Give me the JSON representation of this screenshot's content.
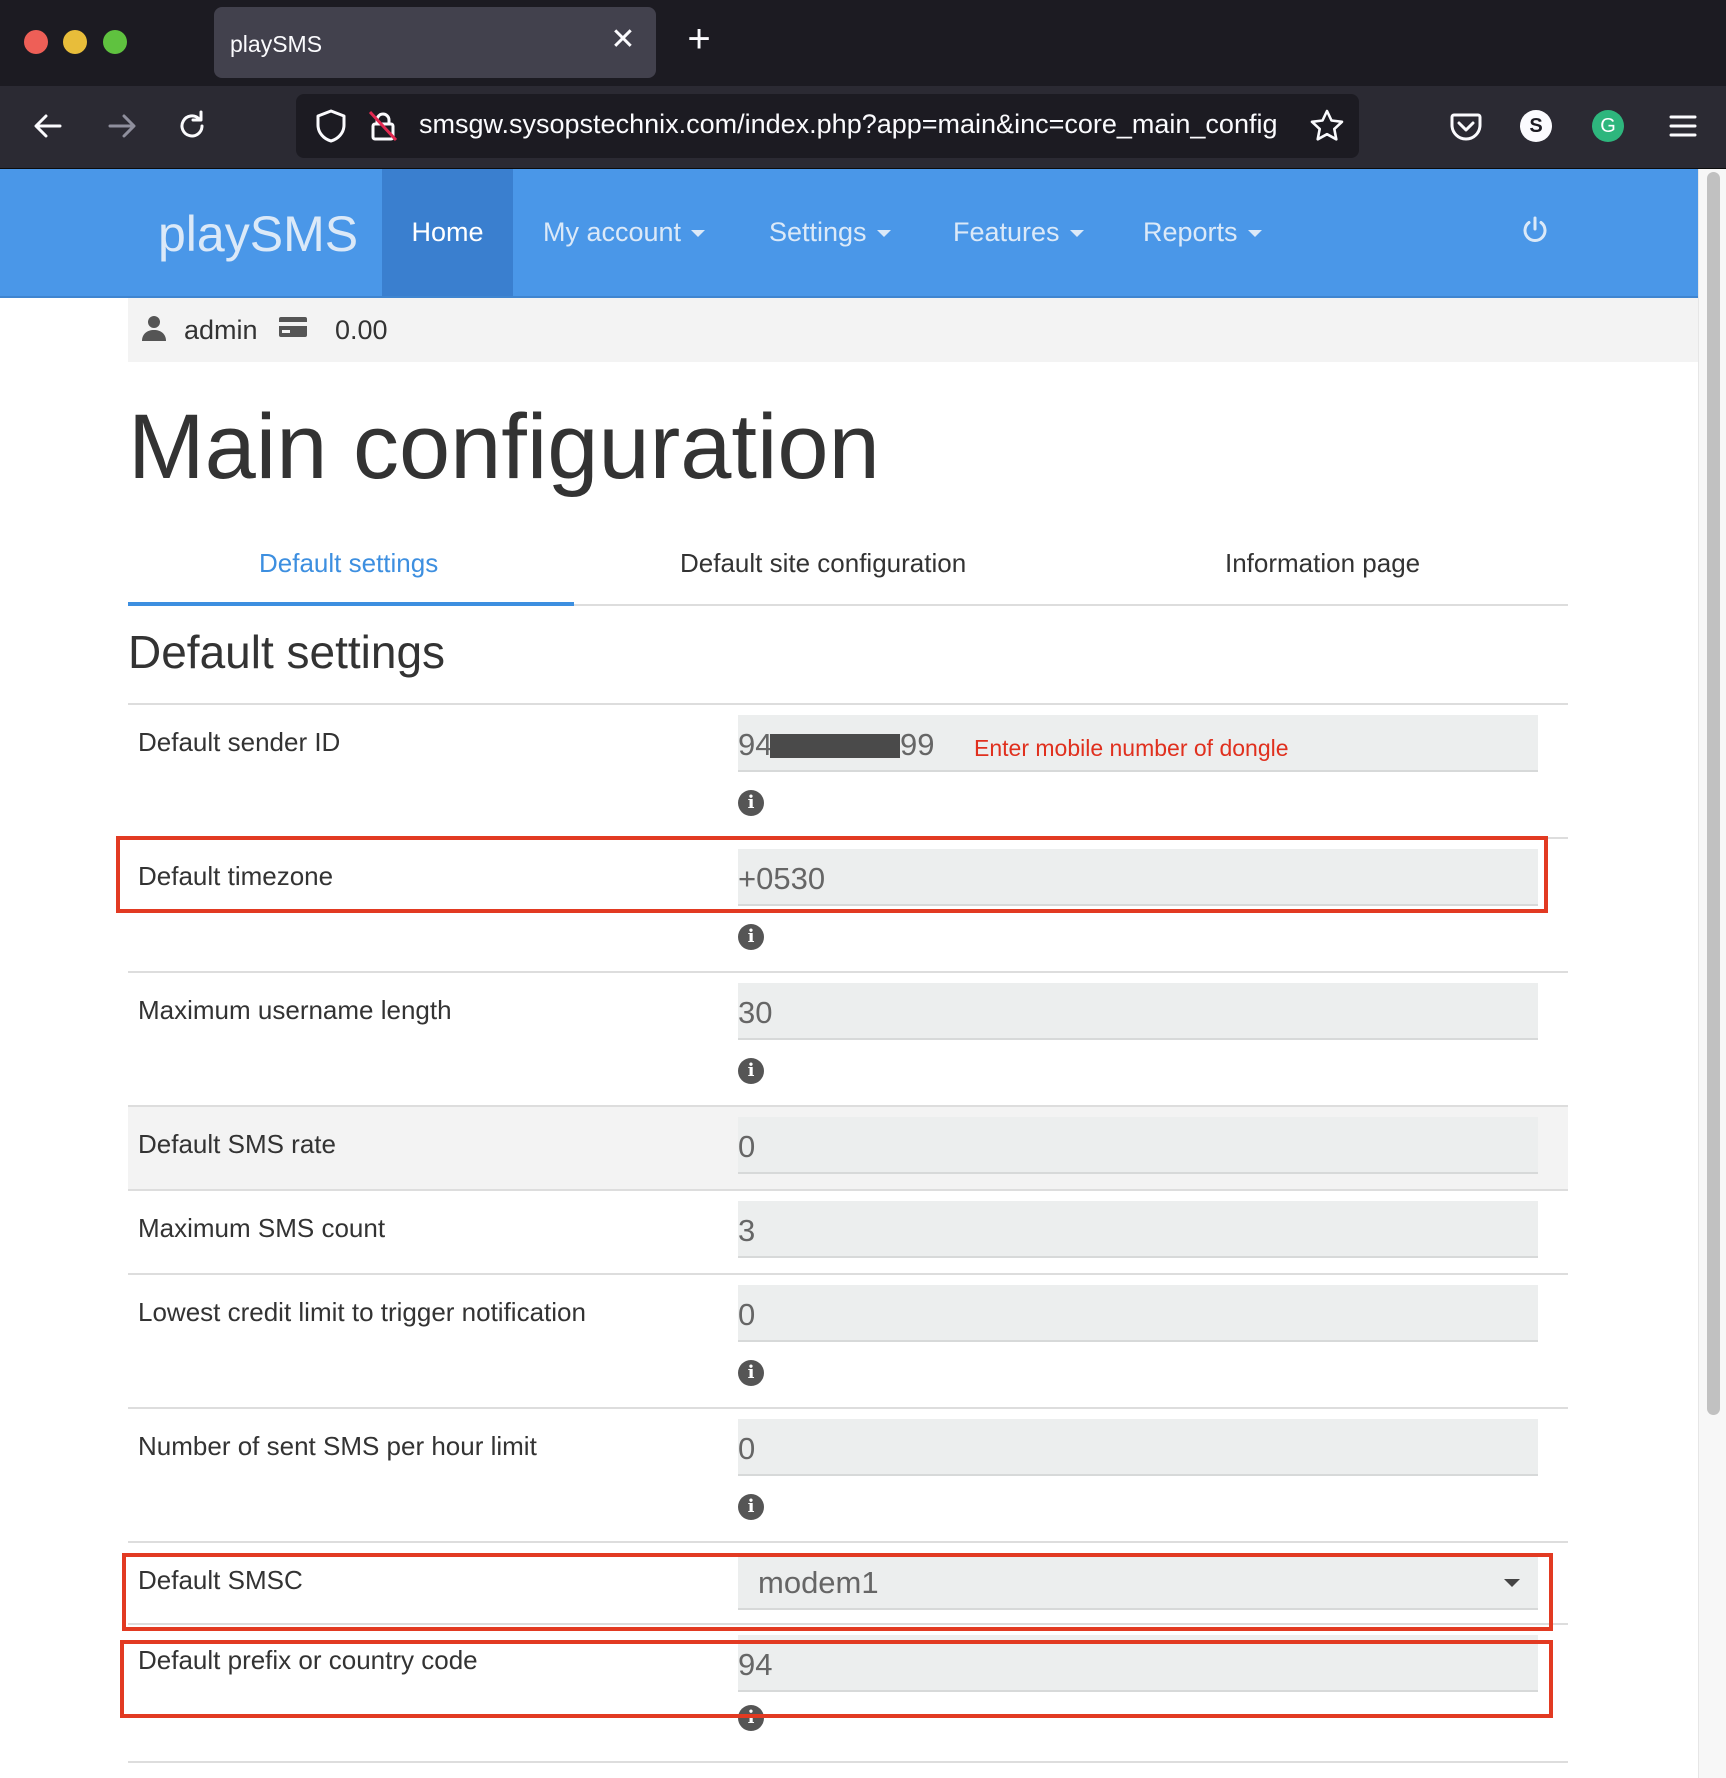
{
  "browser": {
    "tab_title": "playSMS",
    "tab_close": "✕",
    "new_tab": "+",
    "url": "smsgw.sysopstechnix.com/index.php?app=main&inc=core_main_config",
    "avatar_s": "S",
    "avatar_g": "G"
  },
  "appbar": {
    "brand": "playSMS",
    "menu": [
      {
        "label": "Home",
        "active": true
      },
      {
        "label": "My account",
        "dropdown": true
      },
      {
        "label": "Settings",
        "dropdown": true
      },
      {
        "label": "Features",
        "dropdown": true
      },
      {
        "label": "Reports",
        "dropdown": true
      }
    ]
  },
  "user": {
    "name": "admin",
    "credit": "0.00"
  },
  "page": {
    "title": "Main configuration",
    "tabs": [
      {
        "label": "Default settings",
        "active": true
      },
      {
        "label": "Default site configuration"
      },
      {
        "label": "Information page"
      }
    ],
    "section_title": "Default settings"
  },
  "form": {
    "sender_id": {
      "label": "Default sender ID",
      "value_prefix": "94",
      "value_suffix": "99",
      "hint": "Enter mobile number of dongle"
    },
    "timezone": {
      "label": "Default timezone",
      "value": "+0530"
    },
    "max_username": {
      "label": "Maximum username length",
      "value": "30"
    },
    "sms_rate": {
      "label": "Default SMS rate",
      "value": "0"
    },
    "max_sms_count": {
      "label": "Maximum SMS count",
      "value": "3"
    },
    "credit_limit": {
      "label": "Lowest credit limit to trigger notification",
      "value": "0"
    },
    "sms_per_hour": {
      "label": "Number of sent SMS per hour limit",
      "value": "0"
    },
    "smsc": {
      "label": "Default SMSC",
      "value": "modem1"
    },
    "prefix": {
      "label": "Default prefix or country code",
      "value": "94"
    }
  },
  "icons": {
    "info": "i",
    "info_name": "info-icon"
  },
  "colors": {
    "appbar": "#4a97e8",
    "accent": "#3d8fe0",
    "highlight": "#e23a22",
    "hint": "#e0301e"
  }
}
